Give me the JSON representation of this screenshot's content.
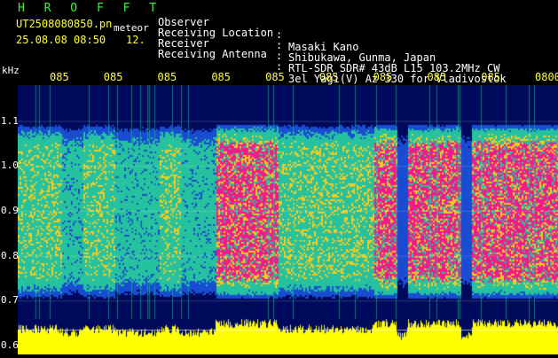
{
  "header": {
    "program": "H R O F F T",
    "file_name": "UT2508080850.pn",
    "meteor_label": "meteor",
    "date_time": "25.08.08 08:50",
    "count": "12.",
    "observer_label": "Observer",
    "observer": "Masaki Kano",
    "location_label": "Receiving Location",
    "location": "Shibukawa, Gunma, Japan",
    "receiver_label": "Receiver",
    "receiver": "RTL-SDR SDR# 43dB L15 103.2MHz CW",
    "antenna_label": "Receiving Antenna",
    "antenna": "3el Yagi(V) Az 330 for Vladivostok",
    "separator": ":"
  },
  "colors": {
    "background": "#000a5c",
    "weak": "#1a4fd6",
    "medium": "#28c8a0",
    "strong": "#ff1a8c",
    "trace": "#ffff00",
    "header_green": "#2aff2a",
    "header_yellow": "#ffff33"
  },
  "chart_data": {
    "type": "heatmap",
    "y_unit": "kHz",
    "y_ticks": [
      "1.1",
      "1.0",
      "0.9",
      "0.8",
      "0.7",
      "0.6"
    ],
    "x_ticks": [
      "085",
      "085",
      "085",
      "085",
      "085",
      "085",
      "085",
      "085",
      "085",
      "0800"
    ],
    "ylim": [
      0.58,
      1.18
    ],
    "echo_band_khz": [
      0.76,
      1.04
    ],
    "bursts": [
      {
        "start_frac": 0.365,
        "end_frac": 0.48,
        "intensity": "strong"
      },
      {
        "start_frac": 0.72,
        "end_frac": 0.82,
        "intensity": "strong"
      },
      {
        "start_frac": 0.84,
        "end_frac": 1.0,
        "intensity": "strong"
      },
      {
        "start_frac": 0.66,
        "end_frac": 0.7,
        "intensity": "strong"
      },
      {
        "start_frac": 0.0,
        "end_frac": 0.08,
        "intensity": "medium"
      },
      {
        "start_frac": 0.12,
        "end_frac": 0.18,
        "intensity": "medium"
      },
      {
        "start_frac": 0.26,
        "end_frac": 0.3,
        "intensity": "medium"
      },
      {
        "start_frac": 0.48,
        "end_frac": 0.66,
        "intensity": "medium"
      },
      {
        "start_frac": 0.08,
        "end_frac": 0.12,
        "intensity": "weak"
      },
      {
        "start_frac": 0.18,
        "end_frac": 0.26,
        "intensity": "weak"
      },
      {
        "start_frac": 0.3,
        "end_frac": 0.365,
        "intensity": "weak"
      }
    ]
  }
}
